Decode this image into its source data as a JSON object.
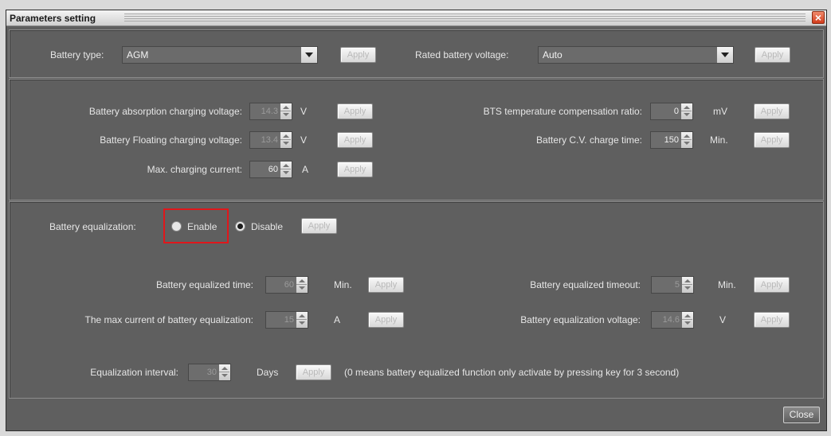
{
  "window": {
    "title": "Parameters setting",
    "close_icon": "close-icon"
  },
  "top": {
    "battery_type_label": "Battery type:",
    "battery_type_value": "AGM",
    "rated_voltage_label": "Rated battery voltage:",
    "rated_voltage_value": "Auto",
    "apply": "Apply"
  },
  "charging": {
    "absorption_label": "Battery absorption charging voltage:",
    "absorption_value": "14.3",
    "absorption_unit": "V",
    "floating_label": "Battery Floating charging voltage:",
    "floating_value": "13.4",
    "floating_unit": "V",
    "max_current_label": "Max. charging current:",
    "max_current_value": "60",
    "max_current_unit": "A",
    "bts_label": "BTS temperature compensation ratio:",
    "bts_value": "0",
    "bts_unit": "mV",
    "cv_time_label": "Battery C.V. charge time:",
    "cv_time_value": "150",
    "cv_time_unit": "Min.",
    "apply": "Apply"
  },
  "equalization": {
    "label": "Battery equalization:",
    "enable_label": "Enable",
    "disable_label": "Disable",
    "selected": "Disable",
    "apply": "Apply",
    "eq_time_label": "Battery equalized time:",
    "eq_time_value": "60",
    "eq_time_unit": "Min.",
    "max_current_label": "The max current of battery equalization:",
    "max_current_value": "15",
    "max_current_unit": "A",
    "timeout_label": "Battery equalized timeout:",
    "timeout_value": "5",
    "timeout_unit": "Min.",
    "voltage_label": "Battery equalization voltage:",
    "voltage_value": "14.6",
    "voltage_unit": "V",
    "interval_label": "Equalization interval:",
    "interval_value": "30",
    "interval_unit": "Days",
    "interval_note": "(0 means battery equalized function only activate by pressing key for 3 second)"
  },
  "footer": {
    "close_label": "Close"
  },
  "colors": {
    "panel_bg": "#5f5f5f",
    "highlight": "#e0171b"
  }
}
